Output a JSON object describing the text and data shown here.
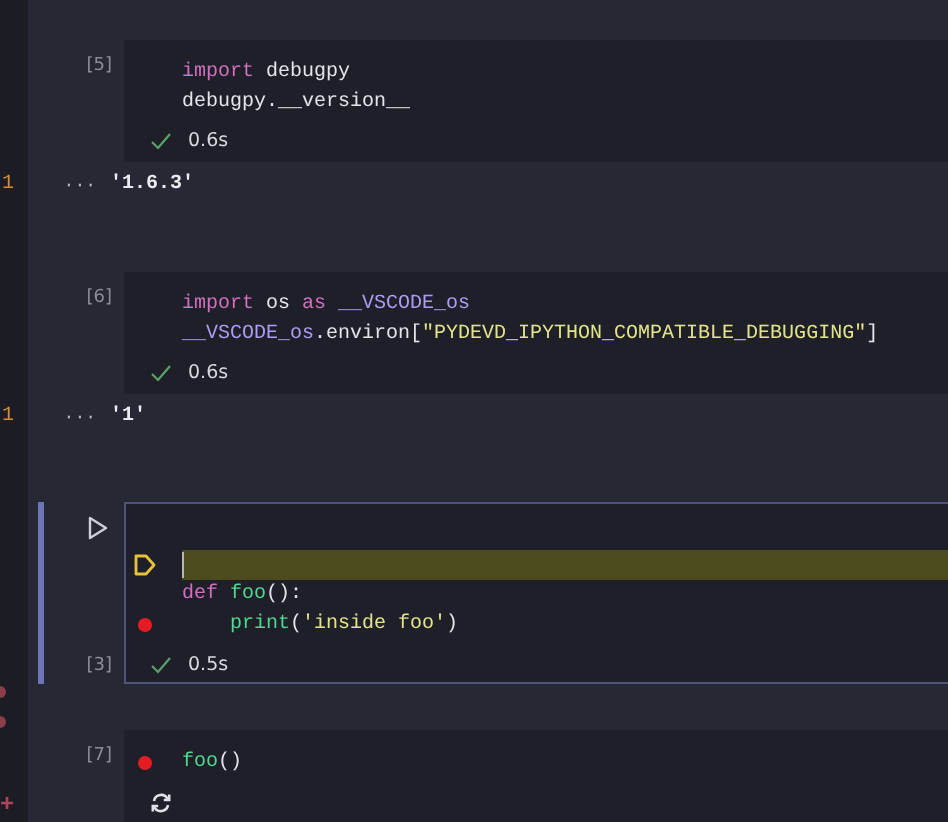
{
  "items": [
    {
      "kind": "cell",
      "selected": false,
      "execution_count": "[5]",
      "running": false,
      "duration": "0.6s",
      "lines": [
        {
          "current": false,
          "breakpoint": false,
          "tokens": [
            {
              "kind": "keyword",
              "text": "import"
            },
            {
              "kind": "name",
              "text": " debugpy"
            }
          ]
        },
        {
          "current": false,
          "breakpoint": false,
          "tokens": [
            {
              "kind": "name",
              "text": "debugpy.__version__"
            }
          ]
        }
      ]
    },
    {
      "kind": "output",
      "line_number": "1",
      "prompt": "···",
      "text": "'1.6.3'"
    },
    {
      "kind": "cell",
      "selected": false,
      "execution_count": "[6]",
      "running": false,
      "duration": "0.6s",
      "lines": [
        {
          "current": false,
          "breakpoint": false,
          "tokens": [
            {
              "kind": "keyword",
              "text": "import"
            },
            {
              "kind": "name",
              "text": " os "
            },
            {
              "kind": "keyword",
              "text": "as"
            },
            {
              "kind": "variable",
              "text": " __VSCODE_os"
            }
          ]
        },
        {
          "current": false,
          "breakpoint": false,
          "tokens": [
            {
              "kind": "variable",
              "text": "__VSCODE_os"
            },
            {
              "kind": "name",
              "text": ".environ["
            },
            {
              "kind": "string",
              "text": "\"PYDEVD_IPYTHON_COMPATIBLE_DEBUGGING\""
            },
            {
              "kind": "name",
              "text": "]"
            }
          ]
        }
      ]
    },
    {
      "kind": "output",
      "line_number": "1",
      "prompt": "···",
      "text": "'1'"
    },
    {
      "kind": "cell",
      "selected": true,
      "execution_count": "[3]",
      "running": false,
      "duration": "0.5s",
      "lines": [
        {
          "current": false,
          "breakpoint": false
        },
        {
          "current": true,
          "breakpoint": false
        },
        {
          "current": false,
          "breakpoint": false,
          "tokens": [
            {
              "kind": "keyword",
              "text": "def"
            },
            {
              "kind": "function",
              "text": " foo"
            },
            {
              "kind": "name",
              "text": "():"
            }
          ]
        },
        {
          "current": false,
          "breakpoint": true,
          "tokens": [
            {
              "kind": "function",
              "text": "    print"
            },
            {
              "kind": "name",
              "text": "("
            },
            {
              "kind": "string",
              "text": "'inside foo'"
            },
            {
              "kind": "name",
              "text": ")"
            }
          ]
        }
      ]
    },
    {
      "kind": "gap",
      "marks": [
        {
          "kind": "dot"
        },
        {
          "kind": "dot"
        }
      ]
    },
    {
      "kind": "cell",
      "selected": false,
      "execution_count": "[7]",
      "running": true,
      "gutter_mark": {
        "kind": "plus"
      },
      "lines": [
        {
          "current": false,
          "breakpoint": true,
          "tokens": [
            {
              "kind": "function",
              "text": "foo"
            },
            {
              "kind": "name",
              "text": "()"
            }
          ]
        }
      ]
    }
  ]
}
